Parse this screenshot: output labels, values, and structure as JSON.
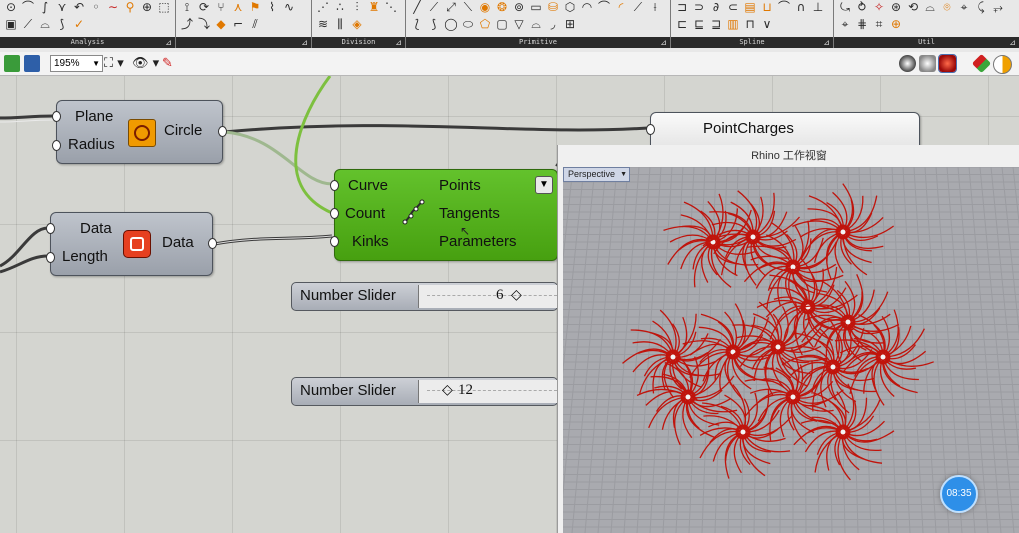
{
  "ribbon": {
    "groups": [
      {
        "name": "Analysis"
      },
      {
        "name": "Division"
      },
      {
        "name": "Primitive"
      },
      {
        "name": "Spline"
      },
      {
        "name": "Util"
      }
    ]
  },
  "toolbar": {
    "zoom": "195%"
  },
  "components": {
    "circle": {
      "inputs": [
        "Plane",
        "Radius"
      ],
      "output": "Circle"
    },
    "data": {
      "inputs": [
        "Data",
        "Length"
      ],
      "output": "Data"
    },
    "divide": {
      "inputs": [
        "Curve",
        "Count",
        "Kinks"
      ],
      "outputs": [
        "Points",
        "Tangents",
        "Parameters"
      ]
    },
    "point_charges": {
      "title": "PointCharges"
    }
  },
  "sliders": [
    {
      "name": "Number Slider",
      "value": "6"
    },
    {
      "name": "Number Slider",
      "value": "12"
    }
  ],
  "rhino": {
    "title": "Rhino 工作视窗",
    "viewport": "Perspective"
  },
  "time_badge": "08:35",
  "colors": {
    "component_green": "#55b01c",
    "field_lines": "#c0140c",
    "accent_orange": "#e07800"
  }
}
